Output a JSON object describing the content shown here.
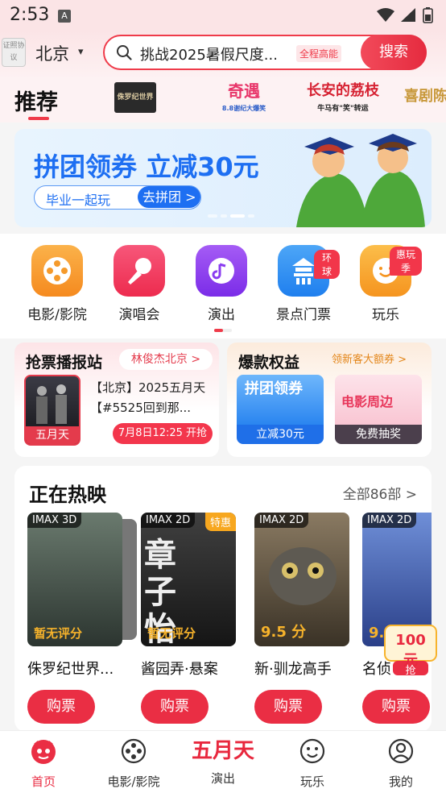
{
  "status": {
    "time": "2:53",
    "a_icon": "A"
  },
  "header": {
    "badge": "证照协议",
    "city": "北京",
    "search_text": "挑战2025暑假尺度...",
    "search_tag": "全程高能",
    "search_button": "搜索"
  },
  "tabs": {
    "current": "推荐",
    "logos": [
      "侏罗纪世界",
      "奇遇",
      "8.8谢纪大爆笑",
      "长安的荔枝",
      "牛马有\"笑\"转运",
      "喜剧",
      "陈"
    ]
  },
  "banner": {
    "title": "拼团领券 立减30元",
    "pill_left": "毕业一起玩",
    "pill_right": "去拼团 >"
  },
  "categories": [
    {
      "label": "电影/影院",
      "color": "#f99a2b",
      "icon": "film-reel-icon",
      "tag": ""
    },
    {
      "label": "演唱会",
      "color": "#f03a5a",
      "icon": "microphone-icon",
      "tag": ""
    },
    {
      "label": "演出",
      "color": "#8a3cf0",
      "icon": "music-note-icon",
      "tag": ""
    },
    {
      "label": "景点门票",
      "color": "#2a8cf2",
      "icon": "temple-icon",
      "tag": "环球"
    },
    {
      "label": "玩乐",
      "color": "#f9a52b",
      "icon": "smile-icon",
      "tag": "惠玩季"
    }
  ],
  "ticket_card": {
    "title": "抢票播报站",
    "tag": "林俊杰北京 >",
    "poster_label": "五月天",
    "desc": "【北京】2025五月天【#5525回到那...",
    "time": "7月8日12:25 开抢"
  },
  "benefit_card": {
    "title": "爆款权益",
    "tag": "领新客大额券 >",
    "items": [
      {
        "img_text": "拼团领券",
        "label": "立减30元"
      },
      {
        "img_text": "电影周边",
        "label": "免费抽奖"
      }
    ]
  },
  "hot": {
    "title": "正在热映",
    "more": "全部86部 >",
    "movies": [
      {
        "format": "IMAX 3D",
        "tag": "",
        "score": "暂无评分",
        "name": "侏罗纪世界...",
        "buy": "购票",
        "bg": "#3c4a44"
      },
      {
        "format": "IMAX 2D",
        "tag": "特惠",
        "score": "暂无评分",
        "name": "酱园弄·悬案",
        "buy": "购票",
        "bg": "#2b2b2b"
      },
      {
        "format": "IMAX 2D",
        "tag": "",
        "score": "9.5 分",
        "name": "新·驯龙高手",
        "buy": "购票",
        "bg": "#5a4d3d"
      },
      {
        "format": "IMAX 2D",
        "tag": "",
        "score": "9.",
        "name": "名侦",
        "buy": "购票",
        "bg": "#3a5aa8"
      }
    ]
  },
  "coupon": {
    "amount": "100元",
    "label": "抢"
  },
  "bottom_nav": [
    {
      "label": "首页",
      "active": true
    },
    {
      "label": "电影/影院",
      "active": false
    },
    {
      "label": "演出",
      "active": false,
      "logo": "五月天"
    },
    {
      "label": "玩乐",
      "active": false
    },
    {
      "label": "我的",
      "active": false
    }
  ]
}
